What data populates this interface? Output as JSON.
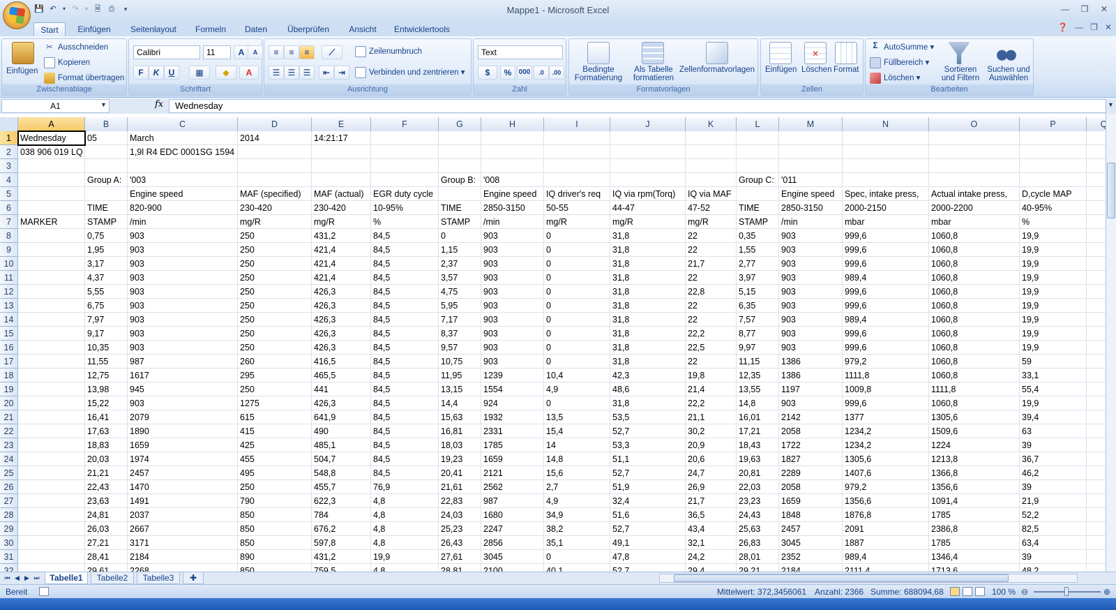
{
  "window": {
    "title": "Mappe1 - Microsoft Excel"
  },
  "tabs": [
    "Start",
    "Einfügen",
    "Seitenlayout",
    "Formeln",
    "Daten",
    "Überprüfen",
    "Ansicht",
    "Entwicklertools"
  ],
  "ribbon": {
    "clipboard": {
      "paste": "Einfügen",
      "cut": "Ausschneiden",
      "copy": "Kopieren",
      "format_painter": "Format übertragen",
      "label": "Zwischenablage"
    },
    "font": {
      "name": "Calibri",
      "size": "11",
      "bold": "F",
      "italic": "K",
      "underline": "U",
      "label": "Schriftart"
    },
    "alignment": {
      "wrap": "Zeilenumbruch",
      "merge": "Verbinden und zentrieren",
      "label": "Ausrichtung"
    },
    "number": {
      "format": "Text",
      "percent": "%",
      "thousands": "000",
      "label": "Zahl"
    },
    "styles": {
      "conditional": "Bedingte Formatierung",
      "as_table": "Als Tabelle formatieren",
      "cell_styles": "Zellenformatvorlagen",
      "label": "Formatvorlagen"
    },
    "cells": {
      "insert": "Einfügen",
      "delete": "Löschen",
      "format": "Format",
      "label": "Zellen"
    },
    "editing": {
      "autosum": "AutoSumme",
      "fill": "Füllbereich",
      "clear": "Löschen",
      "sort": "Sortieren und Filtern",
      "find": "Suchen und Auswählen",
      "label": "Bearbeiten"
    }
  },
  "formula_bar": {
    "name_box": "A1",
    "fx": "fx",
    "value": "Wednesday"
  },
  "columns": [
    "A",
    "B",
    "C",
    "D",
    "E",
    "F",
    "G",
    "H",
    "I",
    "J",
    "K",
    "L",
    "M",
    "N",
    "O",
    "P",
    "Q"
  ],
  "rows": [
    {
      "n": 1,
      "cells": {
        "A": "Wednesday",
        "B": "05",
        "C": "March",
        "D": "2014",
        "E": "14:21:17"
      }
    },
    {
      "n": 2,
      "cells": {
        "A": "038 906 019 LQ",
        "C": "1,9l R4 EDC 0001SG  1594"
      }
    },
    {
      "n": 3,
      "cells": {}
    },
    {
      "n": 4,
      "cells": {
        "B": "Group A:",
        "C": "'003",
        "G": "Group B:",
        "H": "'008",
        "L": "Group C:",
        "M": "'011"
      }
    },
    {
      "n": 5,
      "cells": {
        "C": "Engine speed",
        "D": "MAF (specified)",
        "E": "MAF (actual)",
        "F": "EGR duty cycle",
        "H": "Engine speed",
        "I": "IQ driver's req",
        "J": "IQ via rpm(Torq)",
        "K": "IQ via MAF",
        "M": "Engine speed",
        "N": "Spec, intake press,",
        "O": "Actual intake press,",
        "P": "D,cycle MAP"
      }
    },
    {
      "n": 6,
      "cells": {
        "B": "TIME",
        "C": "820-900",
        "D": "230-420",
        "E": "230-420",
        "F": "10-95%",
        "G": "TIME",
        "H": "2850-3150",
        "I": "50-55",
        "J": "44-47",
        "K": "47-52",
        "L": "TIME",
        "M": "2850-3150",
        "N": "2000-2150",
        "O": "2000-2200",
        "P": "40-95%"
      }
    },
    {
      "n": 7,
      "cells": {
        "A": "MARKER",
        "B": "STAMP",
        "C": " /min",
        "D": " mg/R",
        "E": " mg/R",
        "F": " %",
        "G": "STAMP",
        "H": " /min",
        "I": " mg/R",
        "J": " mg/R",
        "K": " mg/R",
        "L": "STAMP",
        "M": " /min",
        "N": " mbar",
        "O": " mbar",
        "P": " %"
      }
    },
    {
      "n": 8,
      "cells": {
        "B": "0,75",
        "C": "903",
        "D": "250",
        "E": "431,2",
        "F": "84,5",
        "G": "0",
        "H": "903",
        "I": "0",
        "J": "31,8",
        "K": "22",
        "L": "0,35",
        "M": "903",
        "N": "999,6",
        "O": "1060,8",
        "P": "19,9"
      }
    },
    {
      "n": 9,
      "cells": {
        "B": "1,95",
        "C": "903",
        "D": "250",
        "E": "421,4",
        "F": "84,5",
        "G": "1,15",
        "H": "903",
        "I": "0",
        "J": "31,8",
        "K": "22",
        "L": "1,55",
        "M": "903",
        "N": "999,6",
        "O": "1060,8",
        "P": "19,9"
      }
    },
    {
      "n": 10,
      "cells": {
        "B": "3,17",
        "C": "903",
        "D": "250",
        "E": "421,4",
        "F": "84,5",
        "G": "2,37",
        "H": "903",
        "I": "0",
        "J": "31,8",
        "K": "21,7",
        "L": "2,77",
        "M": "903",
        "N": "999,6",
        "O": "1060,8",
        "P": "19,9"
      }
    },
    {
      "n": 11,
      "cells": {
        "B": "4,37",
        "C": "903",
        "D": "250",
        "E": "421,4",
        "F": "84,5",
        "G": "3,57",
        "H": "903",
        "I": "0",
        "J": "31,8",
        "K": "22",
        "L": "3,97",
        "M": "903",
        "N": "989,4",
        "O": "1060,8",
        "P": "19,9"
      }
    },
    {
      "n": 12,
      "cells": {
        "B": "5,55",
        "C": "903",
        "D": "250",
        "E": "426,3",
        "F": "84,5",
        "G": "4,75",
        "H": "903",
        "I": "0",
        "J": "31,8",
        "K": "22,8",
        "L": "5,15",
        "M": "903",
        "N": "999,6",
        "O": "1060,8",
        "P": "19,9"
      }
    },
    {
      "n": 13,
      "cells": {
        "B": "6,75",
        "C": "903",
        "D": "250",
        "E": "426,3",
        "F": "84,5",
        "G": "5,95",
        "H": "903",
        "I": "0",
        "J": "31,8",
        "K": "22",
        "L": "6,35",
        "M": "903",
        "N": "999,6",
        "O": "1060,8",
        "P": "19,9"
      }
    },
    {
      "n": 14,
      "cells": {
        "B": "7,97",
        "C": "903",
        "D": "250",
        "E": "426,3",
        "F": "84,5",
        "G": "7,17",
        "H": "903",
        "I": "0",
        "J": "31,8",
        "K": "22",
        "L": "7,57",
        "M": "903",
        "N": "989,4",
        "O": "1060,8",
        "P": "19,9"
      }
    },
    {
      "n": 15,
      "cells": {
        "B": "9,17",
        "C": "903",
        "D": "250",
        "E": "426,3",
        "F": "84,5",
        "G": "8,37",
        "H": "903",
        "I": "0",
        "J": "31,8",
        "K": "22,2",
        "L": "8,77",
        "M": "903",
        "N": "999,6",
        "O": "1060,8",
        "P": "19,9"
      }
    },
    {
      "n": 16,
      "cells": {
        "B": "10,35",
        "C": "903",
        "D": "250",
        "E": "426,3",
        "F": "84,5",
        "G": "9,57",
        "H": "903",
        "I": "0",
        "J": "31,8",
        "K": "22,5",
        "L": "9,97",
        "M": "903",
        "N": "999,6",
        "O": "1060,8",
        "P": "19,9"
      }
    },
    {
      "n": 17,
      "cells": {
        "B": "11,55",
        "C": "987",
        "D": "260",
        "E": "416,5",
        "F": "84,5",
        "G": "10,75",
        "H": "903",
        "I": "0",
        "J": "31,8",
        "K": "22",
        "L": "11,15",
        "M": "1386",
        "N": "979,2",
        "O": "1060,8",
        "P": "59"
      }
    },
    {
      "n": 18,
      "cells": {
        "B": "12,75",
        "C": "1617",
        "D": "295",
        "E": "465,5",
        "F": "84,5",
        "G": "11,95",
        "H": "1239",
        "I": "10,4",
        "J": "42,3",
        "K": "19,8",
        "L": "12,35",
        "M": "1386",
        "N": "1111,8",
        "O": "1060,8",
        "P": "33,1"
      }
    },
    {
      "n": 19,
      "cells": {
        "B": "13,98",
        "C": "945",
        "D": "250",
        "E": "441",
        "F": "84,5",
        "G": "13,15",
        "H": "1554",
        "I": "4,9",
        "J": "48,6",
        "K": "21,4",
        "L": "13,55",
        "M": "1197",
        "N": "1009,8",
        "O": "1111,8",
        "P": "55,4"
      }
    },
    {
      "n": 20,
      "cells": {
        "B": "15,22",
        "C": "903",
        "D": "1275",
        "E": "426,3",
        "F": "84,5",
        "G": "14,4",
        "H": "924",
        "I": "0",
        "J": "31,8",
        "K": "22,2",
        "L": "14,8",
        "M": "903",
        "N": "999,6",
        "O": "1060,8",
        "P": "19,9"
      }
    },
    {
      "n": 21,
      "cells": {
        "B": "16,41",
        "C": "2079",
        "D": "615",
        "E": "641,9",
        "F": "84,5",
        "G": "15,63",
        "H": "1932",
        "I": "13,5",
        "J": "53,5",
        "K": "21,1",
        "L": "16,01",
        "M": "2142",
        "N": "1377",
        "O": "1305,6",
        "P": "39,4"
      }
    },
    {
      "n": 22,
      "cells": {
        "B": "17,63",
        "C": "1890",
        "D": "415",
        "E": "490",
        "F": "84,5",
        "G": "16,81",
        "H": "2331",
        "I": "15,4",
        "J": "52,7",
        "K": "30,2",
        "L": "17,21",
        "M": "2058",
        "N": "1234,2",
        "O": "1509,6",
        "P": "63"
      }
    },
    {
      "n": 23,
      "cells": {
        "B": "18,83",
        "C": "1659",
        "D": "425",
        "E": "485,1",
        "F": "84,5",
        "G": "18,03",
        "H": "1785",
        "I": "14",
        "J": "53,3",
        "K": "20,9",
        "L": "18,43",
        "M": "1722",
        "N": "1234,2",
        "O": "1224",
        "P": "39"
      }
    },
    {
      "n": 24,
      "cells": {
        "B": "20,03",
        "C": "1974",
        "D": "455",
        "E": "504,7",
        "F": "84,5",
        "G": "19,23",
        "H": "1659",
        "I": "14,8",
        "J": "51,1",
        "K": "20,6",
        "L": "19,63",
        "M": "1827",
        "N": "1305,6",
        "O": "1213,8",
        "P": "36,7"
      }
    },
    {
      "n": 25,
      "cells": {
        "B": "21,21",
        "C": "2457",
        "D": "495",
        "E": "548,8",
        "F": "84,5",
        "G": "20,41",
        "H": "2121",
        "I": "15,6",
        "J": "52,7",
        "K": "24,7",
        "L": "20,81",
        "M": "2289",
        "N": "1407,6",
        "O": "1366,8",
        "P": "46,2"
      }
    },
    {
      "n": 26,
      "cells": {
        "B": "22,43",
        "C": "1470",
        "D": "250",
        "E": "455,7",
        "F": "76,9",
        "G": "21,61",
        "H": "2562",
        "I": "2,7",
        "J": "51,9",
        "K": "26,9",
        "L": "22,03",
        "M": "2058",
        "N": "979,2",
        "O": "1356,6",
        "P": "39"
      }
    },
    {
      "n": 27,
      "cells": {
        "B": "23,63",
        "C": "1491",
        "D": "790",
        "E": "622,3",
        "F": "4,8",
        "G": "22,83",
        "H": "987",
        "I": "4,9",
        "J": "32,4",
        "K": "21,7",
        "L": "23,23",
        "M": "1659",
        "N": "1356,6",
        "O": "1091,4",
        "P": "21,9"
      }
    },
    {
      "n": 28,
      "cells": {
        "B": "24,81",
        "C": "2037",
        "D": "850",
        "E": "784",
        "F": "4,8",
        "G": "24,03",
        "H": "1680",
        "I": "34,9",
        "J": "51,6",
        "K": "36,5",
        "L": "24,43",
        "M": "1848",
        "N": "1876,8",
        "O": "1785",
        "P": "52,2"
      }
    },
    {
      "n": 29,
      "cells": {
        "B": "26,03",
        "C": "2667",
        "D": "850",
        "E": "676,2",
        "F": "4,8",
        "G": "25,23",
        "H": "2247",
        "I": "38,2",
        "J": "52,7",
        "K": "43,4",
        "L": "25,63",
        "M": "2457",
        "N": "2091",
        "O": "2386,8",
        "P": "82,5"
      }
    },
    {
      "n": 30,
      "cells": {
        "B": "27,21",
        "C": "3171",
        "D": "850",
        "E": "597,8",
        "F": "4,8",
        "G": "26,43",
        "H": "2856",
        "I": "35,1",
        "J": "49,1",
        "K": "32,1",
        "L": "26,83",
        "M": "3045",
        "N": "1887",
        "O": "1785",
        "P": "63,4"
      }
    },
    {
      "n": 31,
      "cells": {
        "B": "28,41",
        "C": "2184",
        "D": "890",
        "E": "431,2",
        "F": "19,9",
        "G": "27,61",
        "H": "3045",
        "I": "0",
        "J": "47,8",
        "K": "24,2",
        "L": "28,01",
        "M": "2352",
        "N": "989,4",
        "O": "1346,4",
        "P": "39"
      }
    },
    {
      "n": 32,
      "cells": {
        "B": "29,61",
        "C": "2268",
        "D": "850",
        "E": "759,5",
        "F": "4,8",
        "G": "28,81",
        "H": "2100",
        "I": "40,1",
        "J": "52,7",
        "K": "29,4",
        "L": "29,21",
        "M": "2184",
        "N": "2111,4",
        "O": "1713,6",
        "P": "48,2"
      }
    }
  ],
  "sheets": [
    "Tabelle1",
    "Tabelle2",
    "Tabelle3"
  ],
  "status": {
    "mode": "Bereit",
    "average": "Mittelwert: 372,3456061",
    "count": "Anzahl: 2366",
    "sum": "Summe: 688094,68",
    "zoom": "100 %"
  }
}
